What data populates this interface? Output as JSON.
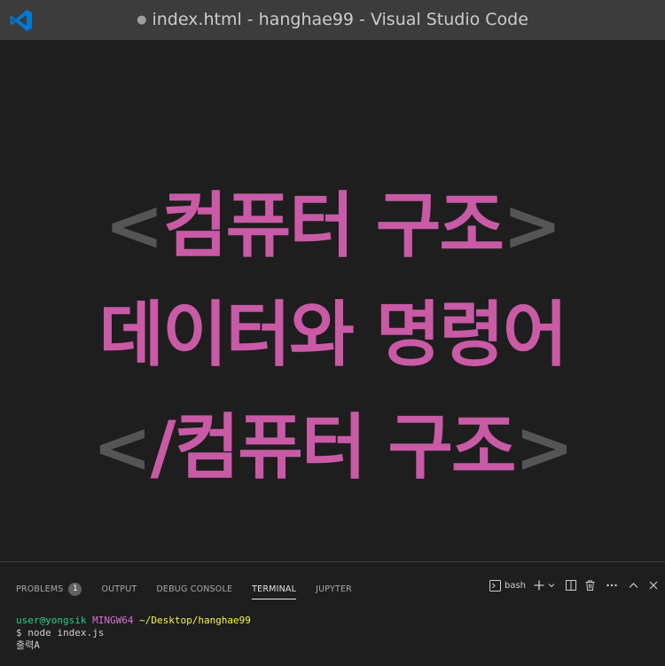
{
  "window": {
    "title": "index.html - hanghae99 - Visual Studio Code",
    "dirty_indicator": "●"
  },
  "editor": {
    "line1": {
      "open": "<",
      "text": "컴퓨터 구조",
      "close": ">"
    },
    "line2": {
      "text": "데이터와 명령어"
    },
    "line3": {
      "open": "<",
      "text": "/컴퓨터 구조",
      "close": ">"
    }
  },
  "panel": {
    "tabs": [
      {
        "label": "PROBLEMS",
        "badge": "1"
      },
      {
        "label": "OUTPUT"
      },
      {
        "label": "DEBUG CONSOLE"
      },
      {
        "label": "TERMINAL",
        "active": true
      },
      {
        "label": "JUPYTER"
      }
    ],
    "shell_label": "bash",
    "actions": [
      "terminal-icon",
      "plus-icon",
      "chevron-down-icon",
      "split-icon",
      "trash-icon",
      "more-icon",
      "chevron-up-icon",
      "close-icon"
    ]
  },
  "terminal": {
    "prompt_user": "user@yongsik",
    "prompt_host": "MINGW64",
    "prompt_path": "~/Desktop/hanghae99",
    "command": "$ node index.js",
    "output": "출력A"
  },
  "colors": {
    "accent_pink": "#c95aa6",
    "bracket_gray": "#555555",
    "titlebar": "#3c3c3c",
    "editor_bg": "#1e1e1e"
  }
}
